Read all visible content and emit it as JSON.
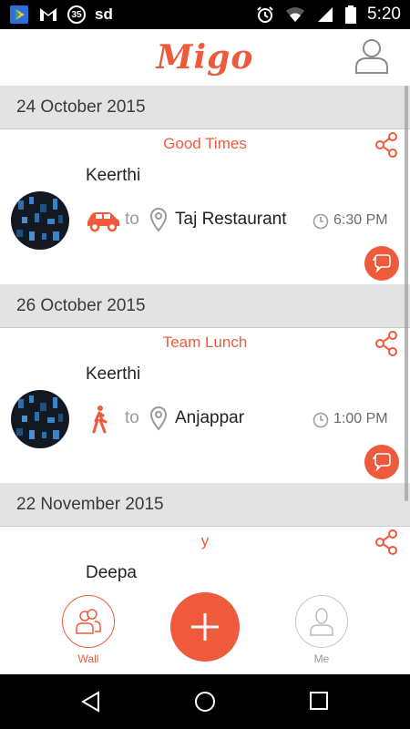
{
  "status_bar": {
    "badge": "35",
    "text": "sd",
    "time": "5:20"
  },
  "header": {
    "logo": "Migo",
    "profile_icon": "user-icon"
  },
  "colors": {
    "accent": "#f05a3c",
    "date_header_bg": "#e3e3e3"
  },
  "feed": [
    {
      "date": "24 October 2015",
      "title": "Good Times",
      "name": "Keerthi",
      "mode": "car-icon",
      "to": "to",
      "place": "Taj Restaurant",
      "time": "6:30 PM"
    },
    {
      "date": "26 October 2015",
      "title": "Team Lunch",
      "name": "Keerthi",
      "mode": "walk-icon",
      "to": "to",
      "place": "Anjappar",
      "time": "1:00 PM"
    },
    {
      "date": "22 November 2015",
      "title": "y",
      "name": "Deepa",
      "mode": "",
      "to": "",
      "place": "",
      "time": ""
    }
  ],
  "bottom_nav": {
    "wall_label": "Wall",
    "me_label": "Me",
    "add_icon": "plus-icon"
  }
}
